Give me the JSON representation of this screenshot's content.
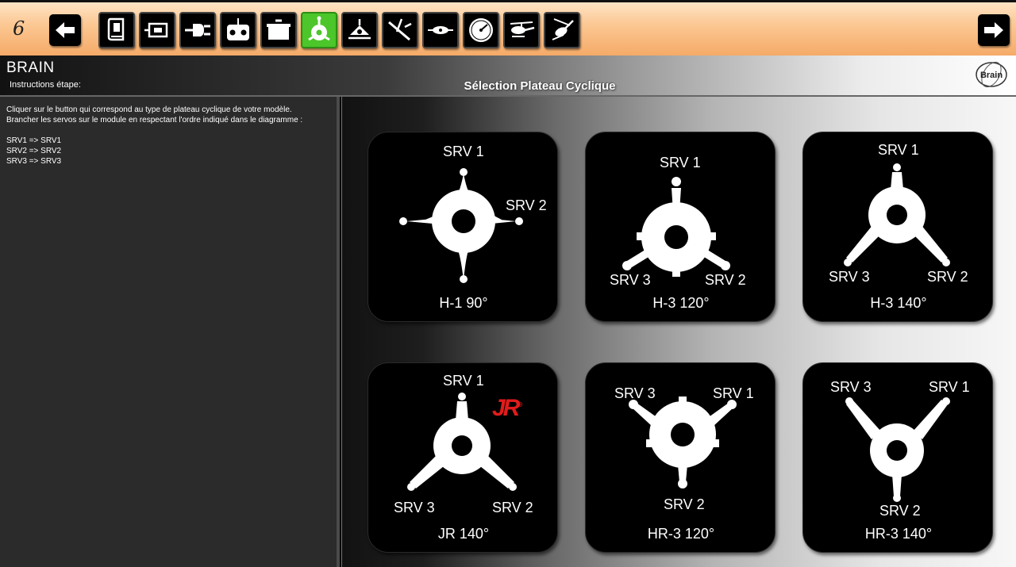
{
  "toolbar": {
    "step_number": "6",
    "buttons": [
      {
        "name": "back-button",
        "icon": "arrow-left-icon"
      },
      {
        "name": "manual-button",
        "icon": "book-icon"
      },
      {
        "name": "module-button",
        "icon": "module-box-icon"
      },
      {
        "name": "connection-button",
        "icon": "plug-icon"
      },
      {
        "name": "transmitter-button",
        "icon": "radio-transmitter-icon"
      },
      {
        "name": "box-button",
        "icon": "box-icon"
      },
      {
        "name": "swashplate-button",
        "icon": "swashplate-icon",
        "active": true
      },
      {
        "name": "rotor-head-button",
        "icon": "rotor-head-icon"
      },
      {
        "name": "tail-button",
        "icon": "tail-rotor-icon"
      },
      {
        "name": "tail-servo-button",
        "icon": "tail-boom-icon"
      },
      {
        "name": "gauge-button",
        "icon": "gauge-icon"
      },
      {
        "name": "helicopter-button",
        "icon": "helicopter-icon"
      },
      {
        "name": "flight-button",
        "icon": "flying-helicopter-icon"
      },
      {
        "name": "next-button",
        "icon": "arrow-right-icon"
      }
    ]
  },
  "header": {
    "app_title": "BRAIN",
    "instructions_label": "Instructions étape:",
    "page_title": "Sélection Plateau Cyclique",
    "logo_text": "Brain"
  },
  "instructions": {
    "line1": "Cliquer sur le button qui correspond au type de plateau cyclique de votre modèle.",
    "line2": "Brancher les servos sur le module en respectant l'ordre indiqué dans le diagramme :",
    "mapping1": "SRV1 => SRV1",
    "mapping2": "SRV2 => SRV2",
    "mapping3": "SRV3 => SRV3"
  },
  "tiles": [
    {
      "id": "h1-90",
      "caption": "H-1 90°",
      "srv1": "SRV 1",
      "srv2": "SRV 2"
    },
    {
      "id": "h3-120",
      "caption": "H-3 120°",
      "srv1": "SRV 1",
      "srv2": "SRV 2",
      "srv3": "SRV 3"
    },
    {
      "id": "h3-140",
      "caption": "H-3 140°",
      "srv1": "SRV 1",
      "srv2": "SRV 2",
      "srv3": "SRV 3"
    },
    {
      "id": "jr-140",
      "caption": "JR 140°",
      "srv1": "SRV 1",
      "srv2": "SRV 2",
      "srv3": "SRV 3",
      "brand": "JR"
    },
    {
      "id": "hr3-120",
      "caption": "HR-3 120°",
      "srv1": "SRV 1",
      "srv2": "SRV 2",
      "srv3": "SRV 3"
    },
    {
      "id": "hr3-140",
      "caption": "HR-3 140°",
      "srv1": "SRV 1",
      "srv2": "SRV 2",
      "srv3": "SRV 3"
    }
  ],
  "colors": {
    "toolbar_accent": "#f5aa68",
    "active_button": "#4cc62a",
    "jr_brand": "#e21b1b"
  }
}
